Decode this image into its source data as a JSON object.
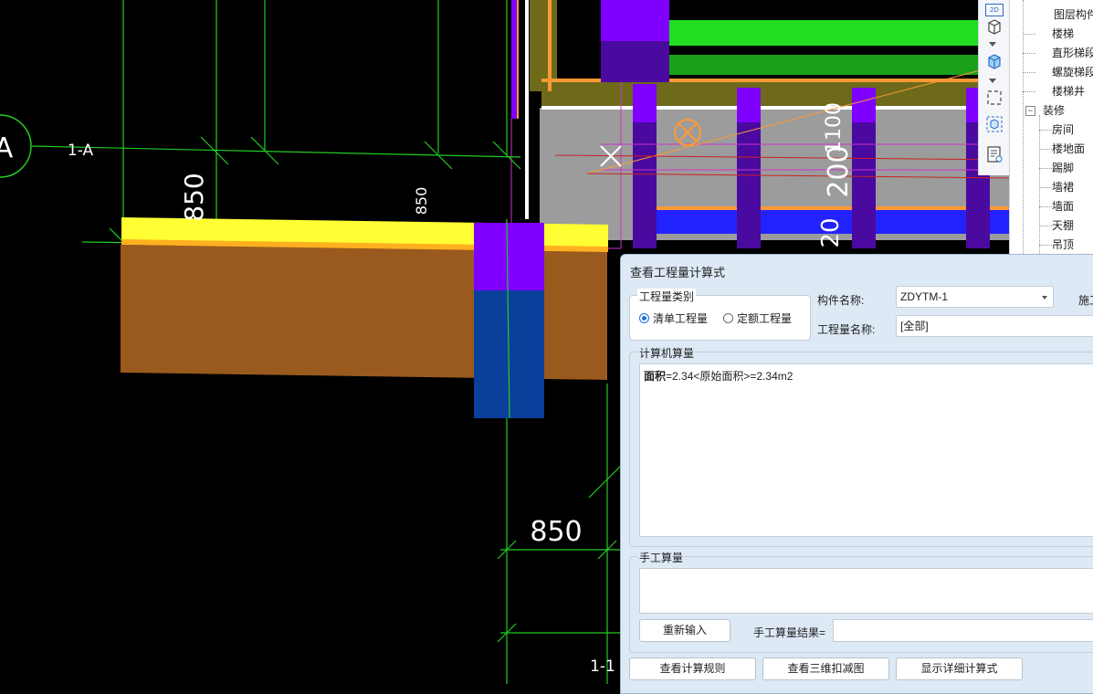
{
  "canvas": {
    "axis_label_top": "1-A",
    "axis_bubble": "A",
    "axis_label_bottom": "1-1",
    "dim_left": "850",
    "dim_top_mid": "850",
    "dim_bottom": "850",
    "dim_vert_1": "1100",
    "dim_vert_2": "200",
    "dim_vert_3": "20",
    "colors": {
      "background": "#000000",
      "axis_green": "#22cc22",
      "yellow": "#ffff33",
      "brown": "#9a5a1e",
      "purple": "#7f00ff",
      "blue_column": "#0a3f9c",
      "olive": "#6e6a1a",
      "gray": "#9c9c9c",
      "green_band": "#22dd22",
      "blue_band": "#2222ff",
      "orange": "#ff9933",
      "magenta": "#cc33cc"
    }
  },
  "toolbar": {
    "icons": [
      "2d-view-icon",
      "3d-box-icon",
      "dropdown-icon",
      "3d-box-blue-icon",
      "dropdown-icon",
      "select-region-icon",
      "3d-inspect-icon",
      "properties-icon"
    ],
    "btn_2d": "2D"
  },
  "tree": {
    "items": [
      {
        "label": "图层构件",
        "level": 2
      },
      {
        "label": "楼梯",
        "level": 1
      },
      {
        "label": "直形梯段",
        "level": 1
      },
      {
        "label": "螺旋梯段",
        "level": 1
      },
      {
        "label": "楼梯井",
        "level": 1
      },
      {
        "label": "装修",
        "level": 0,
        "toggle": "−"
      },
      {
        "label": "房间",
        "level": 1
      },
      {
        "label": "楼地面",
        "level": 1
      },
      {
        "label": "踢脚",
        "level": 1
      },
      {
        "label": "墙裙",
        "level": 1
      },
      {
        "label": "墙面",
        "level": 1
      },
      {
        "label": "天棚",
        "level": 1
      },
      {
        "label": "吊顶",
        "level": 1
      }
    ]
  },
  "dialog": {
    "title": "查看工程量计算式",
    "qty_type_group": "工程量类别",
    "radio_list": "清单工程量",
    "radio_quota": "定额工程量",
    "component_name_label": "构件名称:",
    "component_name_value": "ZDYTM-1",
    "construction_label": "施工",
    "qty_name_label": "工程量名称:",
    "qty_name_value": "[全部]",
    "computer_group": "计算机算量",
    "formula_bold": "面积",
    "formula_rest": "=2.34<原始面积>=2.34m2",
    "manual_group": "手工算量",
    "reenter_button": "重新输入",
    "manual_result_label": "手工算量结果=",
    "view_rules_button": "查看计算规则",
    "view_3d_button": "查看三维扣减图",
    "show_detail_button": "显示详细计算式"
  }
}
